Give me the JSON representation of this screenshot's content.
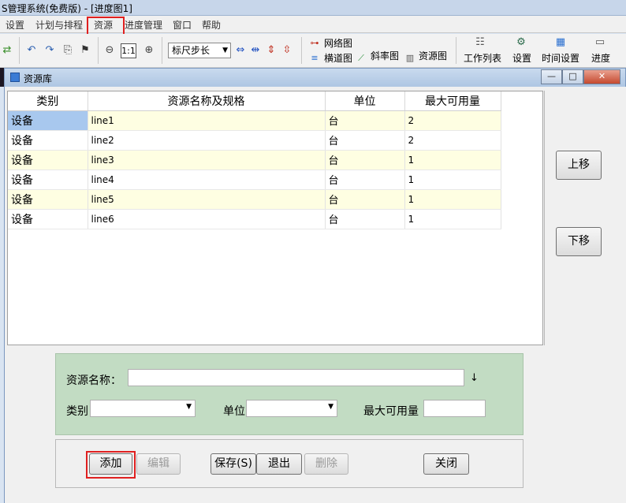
{
  "app": {
    "title": "S管理系统(免费版) - [进度图1]"
  },
  "menu": {
    "items": [
      "设置",
      "计划与排程",
      "资源",
      "进度管理",
      "窗口",
      "帮助"
    ]
  },
  "toolbar": {
    "zoom_label": "1:1",
    "ruler_select_value": "标尺步长",
    "network_label": "网络图",
    "bar_label": "横道图",
    "slope_label": "斜率图",
    "resource_chart_label": "资源图",
    "worklist_label": "工作列表",
    "settings_label": "设置",
    "time_settings_label": "时间设置",
    "progress_label": "进度"
  },
  "window": {
    "title": "资源库",
    "min_glyph": "—",
    "max_glyph": "□",
    "close_glyph": "✕"
  },
  "table": {
    "columns": [
      "类别",
      "资源名称及规格",
      "单位",
      "最大可用量"
    ],
    "rows": [
      {
        "category": "设备",
        "name": "line1",
        "unit": "台",
        "max": "2"
      },
      {
        "category": "设备",
        "name": "line2",
        "unit": "台",
        "max": "2"
      },
      {
        "category": "设备",
        "name": "line3",
        "unit": "台",
        "max": "1"
      },
      {
        "category": "设备",
        "name": "line4",
        "unit": "台",
        "max": "1"
      },
      {
        "category": "设备",
        "name": "line5",
        "unit": "台",
        "max": "1"
      },
      {
        "category": "设备",
        "name": "line6",
        "unit": "台",
        "max": "1"
      }
    ]
  },
  "side": {
    "up_label": "上移",
    "down_label": "下移"
  },
  "form": {
    "name_label": "资源名称：",
    "name_value": "",
    "category_label": "类别",
    "category_value": "",
    "unit_label": "单位",
    "unit_value": "",
    "max_label": "最大可用量",
    "max_value": ""
  },
  "buttons": {
    "add": "添加",
    "edit": "编辑",
    "save": "保存(S)",
    "exit": "退出",
    "delete": "删除",
    "close": "关闭"
  }
}
